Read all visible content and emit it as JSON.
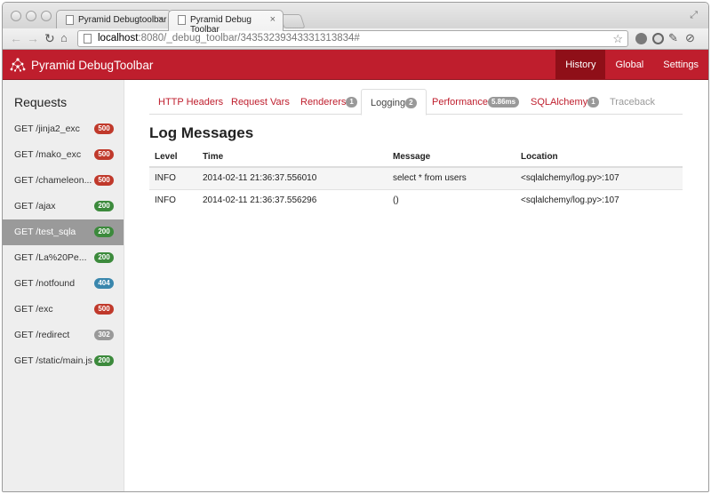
{
  "browser": {
    "tabs": [
      {
        "title": "Pyramid Debugtoolbar",
        "close": "×",
        "active": false
      },
      {
        "title": "Pyramid Debug Toolbar",
        "close": "×",
        "active": true
      }
    ],
    "url": {
      "host": "localhost",
      "path": ":8080/_debug_toolbar/34353239343331313834#"
    }
  },
  "app": {
    "brand": "Pyramid DebugToolbar",
    "nav": [
      "History",
      "Global",
      "Settings"
    ]
  },
  "sidebar": {
    "title": "Requests",
    "requests": [
      {
        "label": "GET /jinja2_exc",
        "status": "500",
        "color": "#c0392b"
      },
      {
        "label": "GET /mako_exc",
        "status": "500",
        "color": "#c0392b"
      },
      {
        "label": "GET /chameleon...",
        "status": "500",
        "color": "#c0392b"
      },
      {
        "label": "GET /ajax",
        "status": "200",
        "color": "#3c8a3c"
      },
      {
        "label": "GET /test_sqla",
        "status": "200",
        "color": "#3c8a3c",
        "active": true
      },
      {
        "label": "GET /La%20Pe...",
        "status": "200",
        "color": "#3c8a3c"
      },
      {
        "label": "GET /notfound",
        "status": "404",
        "color": "#3a87ad"
      },
      {
        "label": "GET /exc",
        "status": "500",
        "color": "#c0392b"
      },
      {
        "label": "GET /redirect",
        "status": "302",
        "color": "#999999"
      },
      {
        "label": "GET /static/main.js",
        "status": "200",
        "color": "#3c8a3c"
      }
    ]
  },
  "panel_tabs": [
    {
      "label": "HTTP Headers",
      "badge": ""
    },
    {
      "label": "Request Vars",
      "badge": ""
    },
    {
      "label": "Renderers",
      "badge": "1"
    },
    {
      "label": "Logging",
      "badge": "2"
    },
    {
      "label": "Performance",
      "badge": "5.86ms"
    },
    {
      "label": "SQLAlchemy",
      "badge": "1"
    },
    {
      "label": "Traceback",
      "badge": ""
    }
  ],
  "log": {
    "heading": "Log Messages",
    "columns": [
      "Level",
      "Time",
      "Message",
      "Location"
    ],
    "rows": [
      [
        "INFO",
        "2014-02-11 21:36:37.556010",
        "select * from users",
        "<sqlalchemy/log.py>:107"
      ],
      [
        "INFO",
        "2014-02-11 21:36:37.556296",
        "()",
        "<sqlalchemy/log.py>:107"
      ]
    ]
  }
}
